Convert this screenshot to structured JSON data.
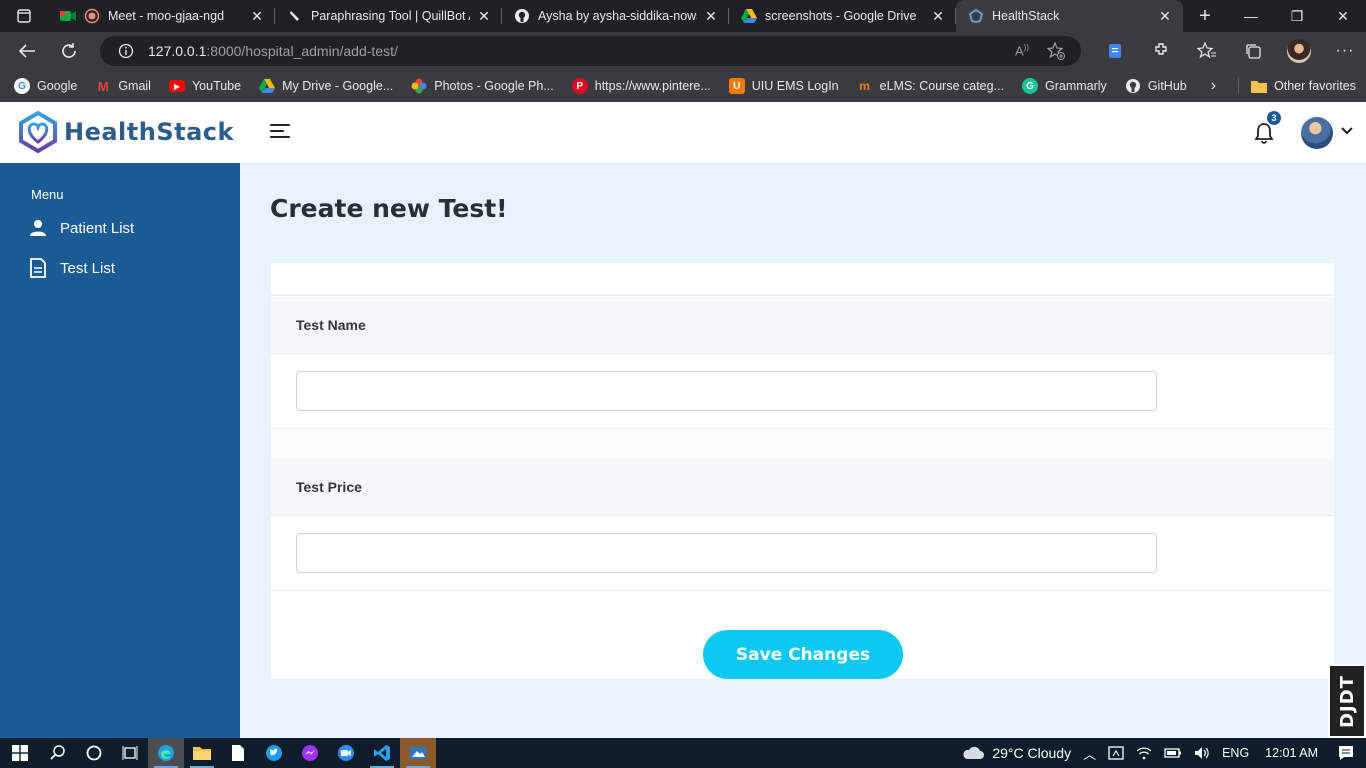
{
  "browser": {
    "tabs": [
      {
        "title": "Meet - moo-gjaa-ngd",
        "icon": "meet-icon"
      },
      {
        "title": "Paraphrasing Tool | QuillBot AI",
        "icon": "quillbot-icon"
      },
      {
        "title": "Aysha by aysha-siddika-nows",
        "icon": "github-icon"
      },
      {
        "title": "screenshots - Google Drive",
        "icon": "drive-icon"
      },
      {
        "title": "HealthStack",
        "icon": "healthstack-icon",
        "active": true
      }
    ],
    "url": {
      "host": "127.0.0.1",
      "rest": ":8000/hospital_admin/add-test/"
    },
    "bookmarks": [
      {
        "label": "Google",
        "icon": "google-icon"
      },
      {
        "label": "Gmail",
        "icon": "gmail-icon"
      },
      {
        "label": "YouTube",
        "icon": "youtube-icon"
      },
      {
        "label": "My Drive - Google...",
        "icon": "drive-icon"
      },
      {
        "label": "Photos - Google Ph...",
        "icon": "photos-icon"
      },
      {
        "label": "https://www.pintere...",
        "icon": "pinterest-icon"
      },
      {
        "label": "UIU EMS LogIn",
        "icon": "uiu-icon"
      },
      {
        "label": "eLMS: Course categ...",
        "icon": "elms-icon"
      },
      {
        "label": "Grammarly",
        "icon": "grammarly-icon"
      },
      {
        "label": "GitHub",
        "icon": "github-icon"
      }
    ],
    "other_favorites": "Other favorites"
  },
  "app": {
    "brand": "HealthStack",
    "notification_count": "3",
    "sidebar": {
      "menu_title": "Menu",
      "items": [
        {
          "label": "Patient List",
          "icon": "person-icon"
        },
        {
          "label": "Test List",
          "icon": "document-icon"
        }
      ]
    },
    "page_title": "Create new Test!",
    "form": {
      "test_name_label": "Test Name",
      "test_name_value": "",
      "test_price_label": "Test Price",
      "test_price_value": "",
      "save_label": "Save Changes"
    },
    "debug_toolbar": "DJDT"
  },
  "taskbar": {
    "weather": "29°C  Cloudy",
    "language": "ENG",
    "time": "12:01 AM"
  },
  "colors": {
    "sidebar": "#1a5b93",
    "page_bg": "#e8f2fd",
    "accent_button": "#0dc9f1",
    "brand_text": "#2c5c89"
  }
}
